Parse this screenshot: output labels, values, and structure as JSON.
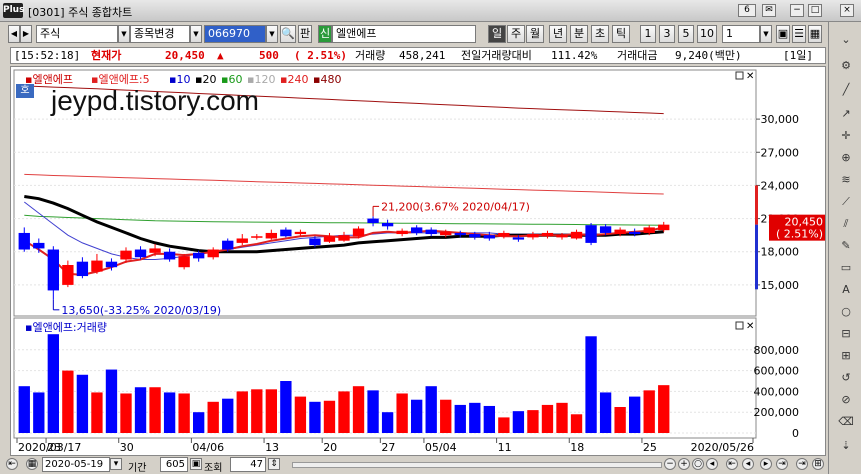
{
  "window": {
    "logo": "Plus",
    "title": "[0301] 주식 종합차트",
    "tab_number": "6",
    "close": "×",
    "minimize": "−",
    "maximize": "□",
    "settings": "✉"
  },
  "toolbar": {
    "arrow_left": "◀",
    "arrow_right": "▶",
    "market": "주식",
    "item_change": "종목변경",
    "code": "066970",
    "pan_label": "판",
    "sin_label": "신",
    "stock_name": "엘앤에프",
    "periods": [
      "일",
      "주",
      "월",
      "년",
      "분",
      "초",
      "틱"
    ],
    "minutes": [
      "1",
      "3",
      "5",
      "10"
    ],
    "selected_minute": "1"
  },
  "info": {
    "time": "[15:52:18]",
    "current_label": "현재가",
    "price": "20,450",
    "arrow": "▲",
    "change": "500",
    "change_pct": "( 2.51%)",
    "volume_label": "거래량",
    "volume": "458,241",
    "prev_volume_label": "전일거래량대비",
    "prev_volume": "111.42%",
    "amount_label": "거래대금",
    "amount": "9,240(백만)",
    "period_badge": "[1일]"
  },
  "price_panel": {
    "legend_name": "엘앤에프",
    "legend_ma": "엘앤에프:5",
    "ma_labels": [
      "10",
      "20",
      "60",
      "120",
      "240",
      "480"
    ],
    "ma_colors": [
      "#0000cc",
      "#000000",
      "#1a9a1a",
      "#aaaaaa",
      "#e02020",
      "#8b0000"
    ],
    "hoga_badge": "호",
    "watermark": "jeypd.tistory.com",
    "y_ticks": [
      "30,000",
      "27,000",
      "24,000",
      "21,000",
      "18,000",
      "15,000"
    ],
    "high_annotation": "21,200(3.67% 2020/04/17)",
    "low_annotation": "13,650(-33.25% 2020/03/19)",
    "price_tag": "20,450",
    "price_tag_pct": "( 2.51%)"
  },
  "volume_panel": {
    "legend": "엘앤에프:거래량",
    "y_ticks": [
      "800,000",
      "600,000",
      "400,000",
      "200,000",
      "0"
    ]
  },
  "x_axis": {
    "labels": [
      "2020/03/17",
      "23",
      "30",
      "04/06",
      "13",
      "20",
      "27",
      "05/04",
      "11",
      "18",
      "25",
      "2020/05/26"
    ]
  },
  "bottom": {
    "date": "2020-05-19",
    "period_label": "기간",
    "period_value": "605",
    "query_label": "조회",
    "query_value": "47"
  },
  "chart_data": {
    "type": "candlestick",
    "ylim": [
      13000,
      32000
    ],
    "candles": [
      {
        "o": 19700,
        "c": 18200,
        "h": 20200,
        "l": 18000
      },
      {
        "o": 18800,
        "c": 18300,
        "h": 19200,
        "l": 17900
      },
      {
        "o": 18200,
        "c": 14500,
        "h": 18500,
        "l": 13650
      },
      {
        "o": 15000,
        "c": 16800,
        "h": 17200,
        "l": 14800
      },
      {
        "o": 17100,
        "c": 15800,
        "h": 17500,
        "l": 15600
      },
      {
        "o": 16200,
        "c": 17200,
        "h": 17800,
        "l": 16000
      },
      {
        "o": 17100,
        "c": 16600,
        "h": 17400,
        "l": 16300
      },
      {
        "o": 17300,
        "c": 18100,
        "h": 18400,
        "l": 17000
      },
      {
        "o": 18200,
        "c": 17500,
        "h": 18500,
        "l": 17300
      },
      {
        "o": 17900,
        "c": 18300,
        "h": 18700,
        "l": 17600
      },
      {
        "o": 18000,
        "c": 17300,
        "h": 18300,
        "l": 17100
      },
      {
        "o": 16600,
        "c": 17600,
        "h": 17800,
        "l": 16400
      },
      {
        "o": 17900,
        "c": 17400,
        "h": 18100,
        "l": 17100
      },
      {
        "o": 17500,
        "c": 18200,
        "h": 18400,
        "l": 17300
      },
      {
        "o": 19000,
        "c": 18200,
        "h": 19200,
        "l": 18000
      },
      {
        "o": 18800,
        "c": 19200,
        "h": 19600,
        "l": 18600
      },
      {
        "o": 19300,
        "c": 19400,
        "h": 19600,
        "l": 19100
      },
      {
        "o": 19200,
        "c": 19700,
        "h": 20000,
        "l": 19100
      },
      {
        "o": 20000,
        "c": 19400,
        "h": 20200,
        "l": 19300
      },
      {
        "o": 19600,
        "c": 19800,
        "h": 20000,
        "l": 19400
      },
      {
        "o": 19200,
        "c": 18600,
        "h": 19400,
        "l": 18400
      },
      {
        "o": 18900,
        "c": 19400,
        "h": 19700,
        "l": 18800
      },
      {
        "o": 19000,
        "c": 19500,
        "h": 19800,
        "l": 18900
      },
      {
        "o": 19400,
        "c": 20100,
        "h": 20300,
        "l": 19200
      },
      {
        "o": 21000,
        "c": 20600,
        "h": 21200,
        "l": 20300
      },
      {
        "o": 20600,
        "c": 20300,
        "h": 20900,
        "l": 20000
      },
      {
        "o": 19600,
        "c": 19900,
        "h": 20100,
        "l": 19400
      },
      {
        "o": 20200,
        "c": 19700,
        "h": 20400,
        "l": 19500
      },
      {
        "o": 20000,
        "c": 19600,
        "h": 20200,
        "l": 19400
      },
      {
        "o": 19500,
        "c": 19800,
        "h": 20000,
        "l": 19300
      },
      {
        "o": 19700,
        "c": 19500,
        "h": 19900,
        "l": 19300
      },
      {
        "o": 19600,
        "c": 19300,
        "h": 19800,
        "l": 19100
      },
      {
        "o": 19500,
        "c": 19200,
        "h": 19800,
        "l": 19000
      },
      {
        "o": 19400,
        "c": 19700,
        "h": 19900,
        "l": 19200
      },
      {
        "o": 19300,
        "c": 19100,
        "h": 19500,
        "l": 18900
      },
      {
        "o": 19300,
        "c": 19600,
        "h": 19800,
        "l": 19100
      },
      {
        "o": 19400,
        "c": 19700,
        "h": 19900,
        "l": 19200
      },
      {
        "o": 19300,
        "c": 19500,
        "h": 19700,
        "l": 19100
      },
      {
        "o": 19200,
        "c": 19800,
        "h": 20000,
        "l": 19100
      },
      {
        "o": 20400,
        "c": 18800,
        "h": 20600,
        "l": 18600
      },
      {
        "o": 20300,
        "c": 19700,
        "h": 20500,
        "l": 19500
      },
      {
        "o": 19600,
        "c": 20000,
        "h": 20200,
        "l": 19400
      },
      {
        "o": 19800,
        "c": 19600,
        "h": 20100,
        "l": 19400
      },
      {
        "o": 19700,
        "c": 20200,
        "h": 20400,
        "l": 19500
      },
      {
        "o": 19950,
        "c": 20450,
        "h": 20700,
        "l": 19800
      }
    ],
    "volumes": [
      450000,
      390000,
      950000,
      600000,
      560000,
      390000,
      610000,
      380000,
      440000,
      440000,
      390000,
      380000,
      200000,
      300000,
      330000,
      400000,
      420000,
      420000,
      500000,
      350000,
      300000,
      310000,
      400000,
      450000,
      410000,
      200000,
      380000,
      320000,
      450000,
      320000,
      270000,
      290000,
      260000,
      150000,
      210000,
      220000,
      270000,
      290000,
      180000,
      930000,
      390000,
      250000,
      350000,
      410000,
      460000
    ],
    "ma5": [
      19000,
      18200,
      17300,
      16000,
      15900,
      16200,
      16600,
      17100,
      17300,
      17800,
      17800,
      17700,
      17800,
      18000,
      18200,
      18500,
      18700,
      19000,
      19200,
      19400,
      19500,
      19400,
      19300,
      19300,
      19700,
      19800,
      19700,
      19800,
      19900,
      19800,
      19700,
      19600,
      19500,
      19400,
      19400,
      19500,
      19500,
      19500,
      19600,
      19500,
      19600,
      19700,
      19800,
      19900,
      20200
    ],
    "ma20": [
      23000,
      22800,
      22400,
      21900,
      21300,
      20700,
      20200,
      19700,
      19200,
      18800,
      18500,
      18300,
      18100,
      18000,
      18000,
      18000,
      18000,
      18100,
      18200,
      18300,
      18400,
      18500,
      18600,
      18800,
      18900,
      19000,
      19100,
      19200,
      19300,
      19300,
      19400,
      19400,
      19400,
      19500,
      19500,
      19500,
      19500,
      19500,
      19500,
      19500,
      19500,
      19600,
      19600,
      19700,
      19800
    ],
    "ma10": [
      22500,
      21500,
      20500,
      19500,
      18800,
      18300,
      17800,
      17500,
      17300,
      17300,
      17400,
      17600,
      17800,
      18000,
      18200,
      18400,
      18600,
      18800,
      19000,
      19200,
      19300,
      19400,
      19500,
      19500,
      19600,
      19700,
      19700,
      19700,
      19700,
      19700,
      19700,
      19700,
      19700,
      19600,
      19600,
      19600,
      19600,
      19600,
      19600,
      19600,
      19600,
      19600,
      19700,
      19700,
      19800
    ],
    "ma60": [
      21300,
      21200,
      21150,
      21100,
      21050,
      21000,
      20950,
      20900,
      20850,
      20800,
      20780,
      20760,
      20740,
      20720,
      20700,
      20690,
      20680,
      20670,
      20660,
      20650,
      20640,
      20630,
      20620,
      20610,
      20600,
      20590,
      20580,
      20570,
      20560,
      20550,
      20540,
      20530,
      20520,
      20510,
      20500,
      20490,
      20480,
      20470,
      20460,
      20450,
      20440,
      20430,
      20420,
      20410,
      20400
    ],
    "ma240": [
      25000,
      24950,
      24900,
      24860,
      24820,
      24780,
      24740,
      24700,
      24660,
      24620,
      24580,
      24540,
      24500,
      24460,
      24420,
      24380,
      24340,
      24300,
      24260,
      24220,
      24180,
      24140,
      24100,
      24060,
      24020,
      23980,
      23940,
      23900,
      23860,
      23820,
      23780,
      23740,
      23700,
      23660,
      23620,
      23580,
      23540,
      23500,
      23460,
      23420,
      23380,
      23340,
      23300,
      23260,
      23220
    ],
    "ma480": [
      33000,
      32950,
      32900,
      32850,
      32800,
      32740,
      32680,
      32620,
      32560,
      32500,
      32440,
      32380,
      32320,
      32260,
      32200,
      32140,
      32080,
      32020,
      31960,
      31900,
      31840,
      31780,
      31720,
      31660,
      31600,
      31540,
      31480,
      31420,
      31360,
      31300,
      31240,
      31180,
      31120,
      31060,
      31000,
      30950,
      30900,
      30850,
      30800,
      30750,
      30700,
      30650,
      30600,
      30550,
      30500
    ]
  }
}
